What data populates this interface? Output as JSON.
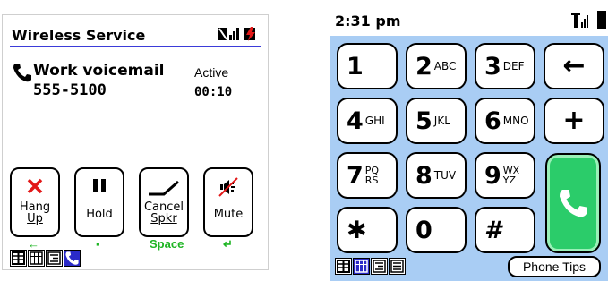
{
  "left_screen": {
    "header_title": "Wireless Service",
    "contact_name": "Work voicemail",
    "phone_number": "555-5100",
    "status": "Active",
    "timer": "00:10",
    "buttons": [
      {
        "line1": "Hang",
        "line2": "Up",
        "icon": "x-icon"
      },
      {
        "line1": "Hold",
        "line2": "",
        "icon": "pause-icon"
      },
      {
        "line1": "Cancel",
        "line2": "Spkr",
        "icon": "speaker-icon"
      },
      {
        "line1": "Mute",
        "line2": "",
        "icon": "mute-icon"
      }
    ],
    "shortcut_hints": [
      "←",
      "▪",
      "Space",
      "↵"
    ],
    "accent_color": "#3b3bd9",
    "hint_color": "#1fb524"
  },
  "right_screen": {
    "time": "2:31 pm",
    "keys": [
      {
        "digit": "1",
        "letters": ""
      },
      {
        "digit": "2",
        "letters": "ABC"
      },
      {
        "digit": "3",
        "letters": "DEF"
      },
      {
        "digit": "←",
        "letters": ""
      },
      {
        "digit": "4",
        "letters": "GHI"
      },
      {
        "digit": "5",
        "letters": "JKL"
      },
      {
        "digit": "6",
        "letters": "MNO"
      },
      {
        "digit": "+",
        "letters": ""
      },
      {
        "digit": "7",
        "letters_top": "PQ",
        "letters_bottom": "RS"
      },
      {
        "digit": "8",
        "letters": "TUV"
      },
      {
        "digit": "9",
        "letters_top": "WX",
        "letters_bottom": "YZ"
      },
      {
        "digit": "✱",
        "letters": ""
      },
      {
        "digit": "0",
        "letters": ""
      },
      {
        "digit": "#",
        "letters": ""
      }
    ],
    "tips_button": "Phone Tips",
    "background_color": "#a9cdf4",
    "talk_color": "#2bcc6a"
  }
}
